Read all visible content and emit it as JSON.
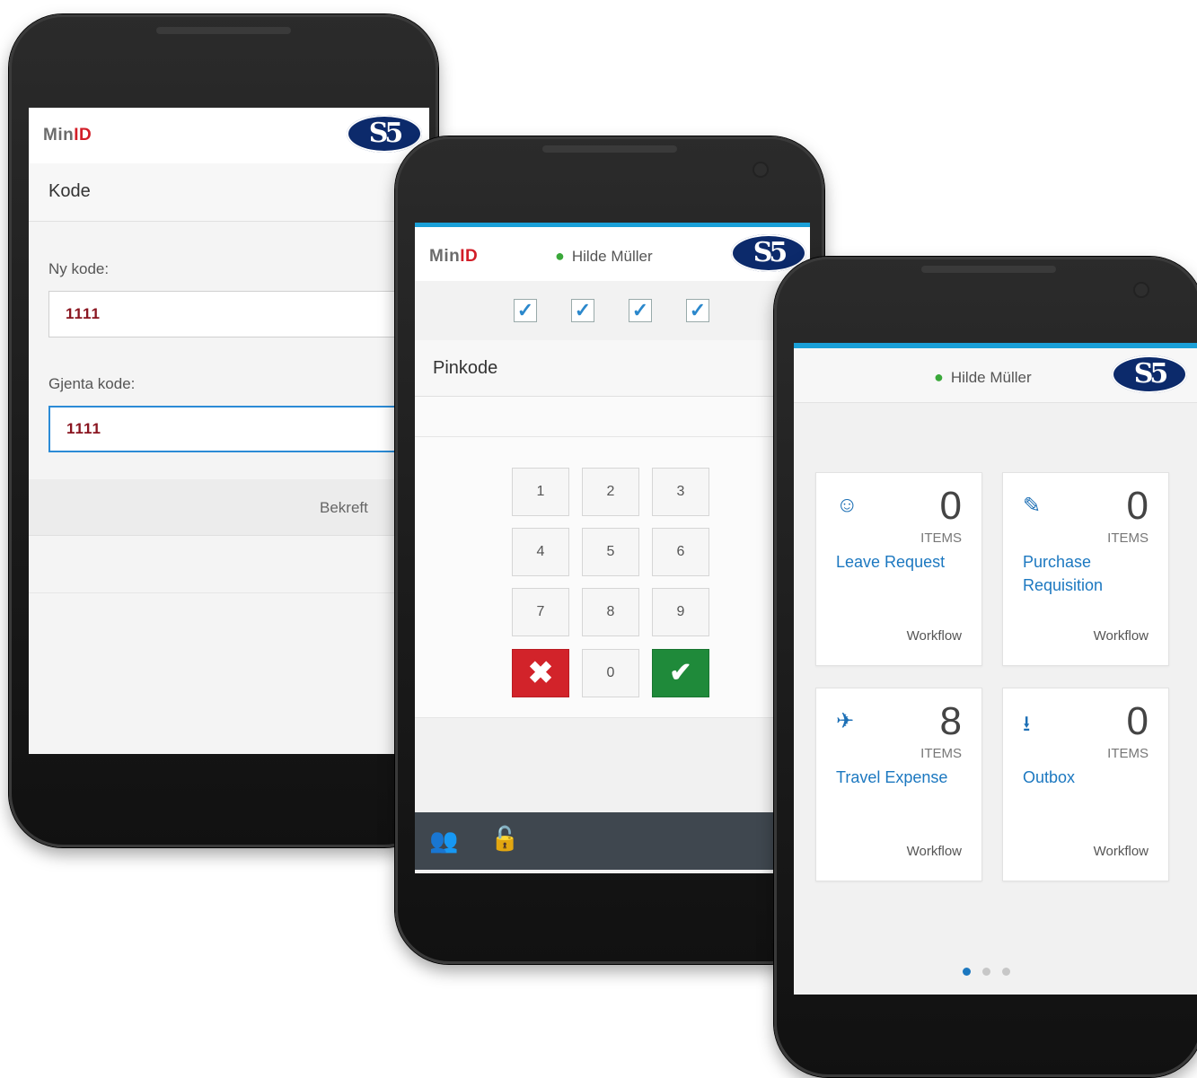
{
  "phone1": {
    "brand": {
      "min": "Min",
      "id": "ID"
    },
    "logo": "S5",
    "section_title": "Kode",
    "new_code_label": "Ny kode:",
    "new_code_value": "1111",
    "repeat_code_label": "Gjenta kode:",
    "repeat_code_value": "1111",
    "confirm_label": "Bekreft"
  },
  "phone2": {
    "brand": {
      "min": "Min",
      "id": "ID"
    },
    "user_name": "Hilde Müller",
    "logo": "S5",
    "pin_title": "Pinkode",
    "pin_progress": "4 of 4",
    "keys": [
      "1",
      "2",
      "3",
      "4",
      "5",
      "6",
      "7",
      "8",
      "9",
      "0"
    ],
    "cancel_glyph": "✖",
    "ok_glyph": "✔"
  },
  "phone3": {
    "user_name": "Hilde Müller",
    "logo": "S5",
    "tiles": [
      {
        "name": "Leave Request",
        "count": "0",
        "items": "ITEMS",
        "footer": "Workflow",
        "icon": "people-icon"
      },
      {
        "name": "Purchase Requisition",
        "count": "0",
        "items": "ITEMS",
        "footer": "Workflow",
        "icon": "edit-icon"
      },
      {
        "name": "Travel Expense",
        "count": "8",
        "items": "ITEMS",
        "footer": "Workflow",
        "icon": "plane-icon"
      },
      {
        "name": "Outbox",
        "count": "0",
        "items": "ITEMS",
        "footer": "Workflow",
        "icon": "download-icon"
      }
    ],
    "page_indicator": {
      "current": 1,
      "total": 3
    }
  },
  "colors": {
    "accent": "#1aa0d8",
    "brand_red": "#d21e28",
    "logo_navy": "#0c2a6b",
    "link_blue": "#1c78c0",
    "ok_green": "#1f8a3a",
    "cancel_red": "#d2232a"
  }
}
